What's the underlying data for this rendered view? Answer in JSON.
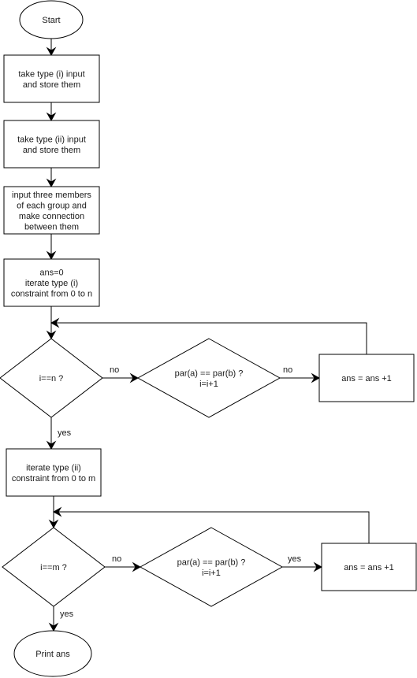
{
  "diagram": {
    "type": "flowchart",
    "nodes": {
      "start": {
        "label": [
          "Start"
        ],
        "shape": "ellipse"
      },
      "input_type_i": {
        "label": [
          "take type (i) input",
          "and store them"
        ],
        "shape": "process"
      },
      "input_type_ii": {
        "label": [
          "take type (ii) input",
          "and store them"
        ],
        "shape": "process"
      },
      "input_groups": {
        "label": [
          "input three members",
          "of each group and",
          "make connection",
          "between them"
        ],
        "shape": "process"
      },
      "init_loop_i": {
        "label": [
          "ans=0",
          "iterate type (i)",
          "constraint from 0 to n"
        ],
        "shape": "process"
      },
      "check_i_eq_n": {
        "label": [
          "i==n ?"
        ],
        "shape": "decision"
      },
      "par_check_1": {
        "label": [
          "par(a) == par(b) ?",
          "i=i+1"
        ],
        "shape": "decision"
      },
      "ans_inc_1": {
        "label": [
          "ans = ans +1"
        ],
        "shape": "process"
      },
      "init_loop_ii": {
        "label": [
          "iterate type (ii)",
          "constraint from 0 to m"
        ],
        "shape": "process"
      },
      "check_i_eq_m": {
        "label": [
          "i==m ?"
        ],
        "shape": "decision"
      },
      "par_check_2": {
        "label": [
          "par(a) == par(b) ?",
          "i=i+1"
        ],
        "shape": "decision"
      },
      "ans_inc_2": {
        "label": [
          "ans = ans +1"
        ],
        "shape": "process"
      },
      "print_ans": {
        "label": [
          "Print ans"
        ],
        "shape": "ellipse"
      }
    },
    "edges": [
      {
        "from": "start",
        "to": "input_type_i",
        "label": ""
      },
      {
        "from": "input_type_i",
        "to": "input_type_ii",
        "label": ""
      },
      {
        "from": "input_type_ii",
        "to": "input_groups",
        "label": ""
      },
      {
        "from": "input_groups",
        "to": "init_loop_i",
        "label": ""
      },
      {
        "from": "init_loop_i",
        "to": "check_i_eq_n",
        "label": ""
      },
      {
        "from": "check_i_eq_n",
        "to": "par_check_1",
        "label": "no"
      },
      {
        "from": "par_check_1",
        "to": "ans_inc_1",
        "label": "no"
      },
      {
        "from": "ans_inc_1",
        "to": "check_i_eq_n",
        "label": ""
      },
      {
        "from": "check_i_eq_n",
        "to": "init_loop_ii",
        "label": "yes"
      },
      {
        "from": "init_loop_ii",
        "to": "check_i_eq_m",
        "label": ""
      },
      {
        "from": "check_i_eq_m",
        "to": "par_check_2",
        "label": "no"
      },
      {
        "from": "par_check_2",
        "to": "ans_inc_2",
        "label": "yes"
      },
      {
        "from": "ans_inc_2",
        "to": "check_i_eq_m",
        "label": ""
      },
      {
        "from": "check_i_eq_m",
        "to": "print_ans",
        "label": "yes"
      }
    ]
  }
}
